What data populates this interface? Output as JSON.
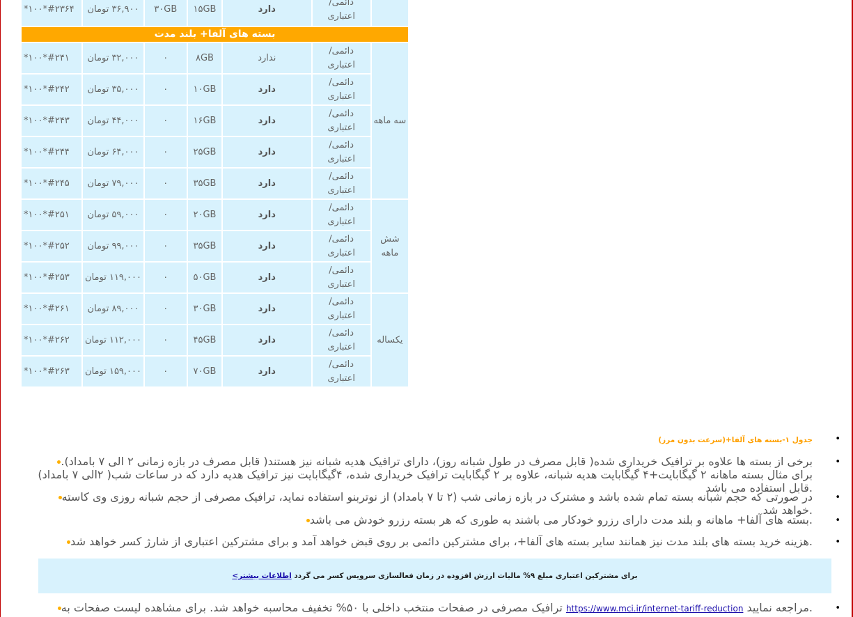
{
  "plans_table": {
    "top_row": {
      "type": "دائمی/ اعتباری",
      "gift": "دارد",
      "volume": "۱۵GB",
      "bonus": "۳۰GB",
      "price": "۳۶,۹۰۰ تومان",
      "code": "#۲۳۶۴*۱۰۰*"
    },
    "section_title": "بسته های آلفا+ بلند مدت",
    "groups": [
      {
        "duration": "سه ماهه",
        "rows": [
          {
            "type": "دائمی/ اعتباری",
            "gift": "ندارد",
            "volume": "۸GB",
            "bonus": "۰",
            "price": "۳۲,۰۰۰ تومان",
            "code": "#۲۴۱*۱۰۰*"
          },
          {
            "type": "دائمی/ اعتباری",
            "gift": "دارد",
            "volume": "۱۰GB",
            "bonus": "۰",
            "price": "۳۵,۰۰۰ تومان",
            "code": "#۲۴۲*۱۰۰*"
          },
          {
            "type": "دائمی/ اعتباری",
            "gift": "دارد",
            "volume": "۱۶GB",
            "bonus": "۰",
            "price": "۴۴,۰۰۰ تومان",
            "code": "#۲۴۳*۱۰۰*"
          },
          {
            "type": "دائمی/ اعتباری",
            "gift": "دارد",
            "volume": "۲۵GB",
            "bonus": "۰",
            "price": "۶۴,۰۰۰ تومان",
            "code": "#۲۴۴*۱۰۰*"
          },
          {
            "type": "دائمی/ اعتباری",
            "gift": "دارد",
            "volume": "۳۵GB",
            "bonus": "۰",
            "price": "۷۹,۰۰۰ تومان",
            "code": "#۲۴۵*۱۰۰*"
          }
        ]
      },
      {
        "duration": "شش ماهه",
        "rows": [
          {
            "type": "دائمی/ اعتباری",
            "gift": "دارد",
            "volume": "۲۰GB",
            "bonus": "۰",
            "price": "۵۹,۰۰۰ تومان",
            "code": "#۲۵۱*۱۰۰*"
          },
          {
            "type": "دائمی/ اعتباری",
            "gift": "دارد",
            "volume": "۳۵GB",
            "bonus": "۰",
            "price": "۹۹,۰۰۰ تومان",
            "code": "#۲۵۲*۱۰۰*"
          },
          {
            "type": "دائمی/ اعتباری",
            "gift": "دارد",
            "volume": "۵۰GB",
            "bonus": "۰",
            "price": "۱۱۹,۰۰۰ تومان",
            "code": "#۲۵۳*۱۰۰*"
          }
        ]
      },
      {
        "duration": "یکساله",
        "rows": [
          {
            "type": "دائمی/ اعتباری",
            "gift": "دارد",
            "volume": "۳۰GB",
            "bonus": "۰",
            "price": "۸۹,۰۰۰ تومان",
            "code": "#۲۶۱*۱۰۰*"
          },
          {
            "type": "دائمی/ اعتباری",
            "gift": "دارد",
            "volume": "۴۵GB",
            "bonus": "۰",
            "price": "۱۱۲,۰۰۰ تومان",
            "code": "#۲۶۲*۱۰۰*"
          },
          {
            "type": "دائمی/ اعتباری",
            "gift": "دارد",
            "volume": "۷۰GB",
            "bonus": "۰",
            "price": "۱۵۹,۰۰۰ تومان",
            "code": "#۲۶۳*۱۰۰*"
          }
        ]
      }
    ]
  },
  "notes": {
    "caption": "جدول ۱-بسته های آلفا+(سرعت بدون مرز)",
    "note1": "برخی از بسته ها علاوه بر ترافیک خریداری شده( قابل مصرف در طول شبانه روز)، دارای ترافیک هدیه شبانه نیز هستند( قابل مصرف در بازه زمانی ۲ الی ۷ بامداد). برای مثال بسته ماهانه ۲ گیگابایت+۴ گیگابایت هدیه شبانه، علاوه بر ۲ گیگابایت ترافیک خریداری شده، ۴گیگابایت نیز ترافیک هدیه دارد که در ساعات شب( ۲الی ۷ بامداد) قابل استفاده می باشد.",
    "note2": "در صورتی که حجم شبانه بسته تمام شده باشد و مشترک در بازه زمانی شب (۲ تا ۷ بامداد) از نوتربنو استفاده نماید، ترافیک مصرفی از حجم شبانه روزی وی کاسته خواهد شد.",
    "note3": "بسته های آلفا+ ماهانه و بلند مدت دارای رزرو خودکار می باشند به طوری که هر بسته رزرو خودش می باشد.",
    "note4": "هزینه خرید بسته های بلند مدت نیز همانند سایر بسته های آلفا+، برای مشترکین دائمی بر روی قبض خواهد آمد و برای مشترکین اعتباری از شارژ کسر خواهد شد.",
    "tax_text": "برای مشترکین اعتباری مبلغ ۹% مالیات ارزش افزوده در زمان فعالسازی سرویس کسر می گردد",
    "tax_link": "اطلاعات بیشتر>",
    "note5_before": "ترافیک مصرفی در صفحات منتخب داخلی با ۵۰% تخفیف محاسبه خواهد شد. برای مشاهده لیست صفحات به",
    "note5_link": "https://www.mci.ir/internet-tariff-reduction",
    "note5_after": "مراجعه نمایید."
  }
}
